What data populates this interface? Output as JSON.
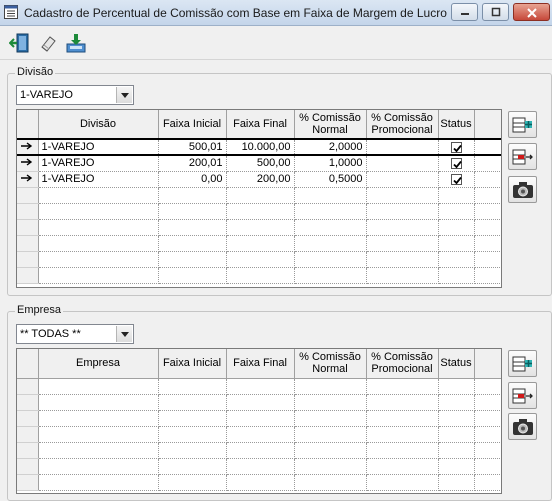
{
  "window": {
    "title": "Cadastro de Percentual de Comissão com Base em Faixa de Margem de Lucro",
    "icon": "form-icon"
  },
  "toolbar": {
    "buttons": [
      {
        "name": "exit-button",
        "icon": "exit-door-icon"
      },
      {
        "name": "edit-button",
        "icon": "eraser-icon"
      },
      {
        "name": "save-button",
        "icon": "save-download-icon"
      }
    ]
  },
  "divisao": {
    "group_label": "Divisão",
    "combo_value": "1-VAREJO",
    "columns": [
      "Divisão",
      "Faixa Inicial",
      "Faixa Final",
      "% Comissão Normal",
      "% Comissão Promocional",
      "Status"
    ],
    "rows": [
      {
        "divisao": "1-VAREJO",
        "faixa_inicial": "500,01",
        "faixa_final": "10.000,00",
        "comissao_normal": "2,0000",
        "comissao_promocional": "",
        "status": true
      },
      {
        "divisao": "1-VAREJO",
        "faixa_inicial": "200,01",
        "faixa_final": "500,00",
        "comissao_normal": "1,0000",
        "comissao_promocional": "",
        "status": true
      },
      {
        "divisao": "1-VAREJO",
        "faixa_inicial": "0,00",
        "faixa_final": "200,00",
        "comissao_normal": "0,5000",
        "comissao_promocional": "",
        "status": true
      }
    ],
    "side_buttons": [
      "add-row-icon",
      "remove-row-icon",
      "camera-icon"
    ]
  },
  "empresa": {
    "group_label": "Empresa",
    "combo_value": "** TODAS **",
    "columns": [
      "Empresa",
      "Faixa Inicial",
      "Faixa Final",
      "% Comissão Normal",
      "% Comissão Promocional",
      "Status"
    ],
    "rows": [],
    "side_buttons": [
      "add-row-icon",
      "remove-row-icon",
      "camera-icon"
    ]
  },
  "colors": {
    "titlebar": "#c4d5ea",
    "close_button": "#c6483a",
    "grid_header": "#f0f0f0"
  }
}
